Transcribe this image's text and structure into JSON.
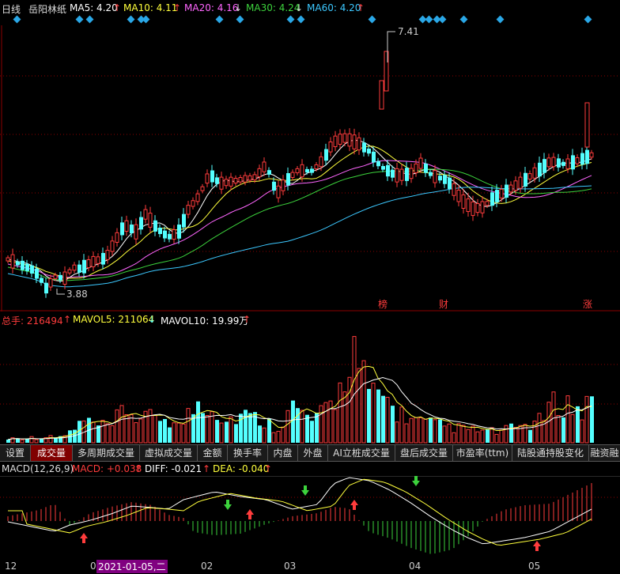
{
  "header": {
    "period": "日线",
    "stock_name": "岳阳林纸",
    "ma5_label": "MA5: 4.20",
    "ma5_arrow": "↑",
    "ma10_label": "MA10: 4.11",
    "ma10_arrow": "↑",
    "ma20_label": "MA20: 4.16",
    "ma20_arrow": "↓",
    "ma30_label": "MA30: 4.24",
    "ma30_arrow": "↓",
    "ma60_label": "MA60: 4.20",
    "ma60_arrow": "↑"
  },
  "price_chart": {
    "high_label": "7.41",
    "low_label": "3.88",
    "tags": [
      "榜",
      "财",
      "涨"
    ]
  },
  "volume": {
    "total_label": "总手: 216494",
    "total_arrow": "↑",
    "mavol5_label": "MAVOL5: 211064",
    "mavol5_arrow": "↓",
    "mavol10_label": "MAVOL10: 19.99万",
    "mavol10_arrow": "↑"
  },
  "tabs": [
    {
      "label": "设置"
    },
    {
      "label": "成交量"
    },
    {
      "label": "多周期成交量"
    },
    {
      "label": "虚拟成交量"
    },
    {
      "label": "金额"
    },
    {
      "label": "换手率"
    },
    {
      "label": "内盘"
    },
    {
      "label": "外盘"
    },
    {
      "label": "AI立桩成交量"
    },
    {
      "label": "盘后成交量"
    },
    {
      "label": "市盈率(ttm)"
    },
    {
      "label": "陆股通持股变化"
    },
    {
      "label": "融资融"
    }
  ],
  "macd": {
    "name_label": "MACD(12,26,9)",
    "macd_label": "MACD: +0.038",
    "macd_arrow": "↑",
    "diff_label": "DIFF: -0.021",
    "diff_arrow": "↑",
    "dea_label": "DEA: -0.040",
    "dea_arrow": "↑"
  },
  "xaxis": {
    "labels": [
      "12",
      "0",
      "2021-01-05,二",
      "02",
      "03",
      "04",
      "05"
    ]
  },
  "colors": {
    "up": "#ff3c3c",
    "down": "#54ffff",
    "ma5": "#ffffff",
    "ma10": "#ffff3c",
    "ma20": "#ff66ff",
    "ma30": "#3cd23c",
    "ma60": "#3cc8ff"
  }
}
